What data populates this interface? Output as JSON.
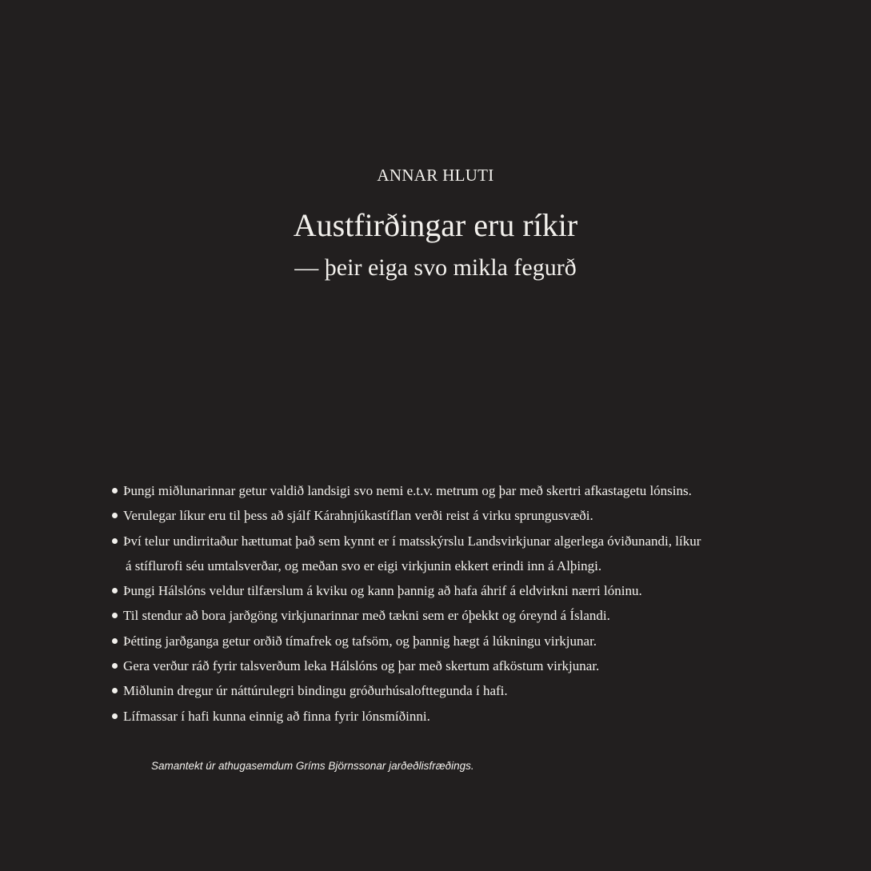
{
  "heading": {
    "part_label": "ANNAR HLUTI",
    "title": "Austfirðingar eru ríkir",
    "subtitle": "— þeir eiga svo mikla fegurð"
  },
  "bullets": [
    {
      "text": "Þungi miðlunarinnar getur valdið landsigi svo nemi e.t.v. metrum og þar með skertri afkastagetu lónsins."
    },
    {
      "text": "Verulegar líkur eru til þess að sjálf Kárahnjúkastíflan verði reist á virku sprungusvæði."
    },
    {
      "text": "Því telur undirritaður hættumat það sem kynnt er í matsskýrslu Landsvirkjunar algerlega óviðunandi, líkur",
      "continuation": "á stíflurofi séu umtalsverðar, og meðan svo er eigi virkjunin ekkert erindi inn á Alþingi."
    },
    {
      "text": "Þungi Hálslóns veldur tilfærslum á kviku og kann þannig að hafa áhrif á eldvirkni nærri lóninu."
    },
    {
      "text": "Til stendur að bora jarðgöng virkjunarinnar með tækni sem er óþekkt og óreynd á Íslandi."
    },
    {
      "text": "Þétting jarðganga getur orðið tímafrek og tafsöm, og þannig hægt á lúkningu virkjunar."
    },
    {
      "text": "Gera verður ráð fyrir talsverðum leka Hálslóns og þar með skertum afköstum virkjunar."
    },
    {
      "text": "Miðlunin dregur úr náttúrulegri bindingu gróðurhúsalofttegunda í hafi."
    },
    {
      "text": "Lífmassar í hafi kunna einnig að finna fyrir lónsmíðinni."
    }
  ],
  "source_note": "Samantekt úr athugasemdum Gríms Björnssonar jarðeðlisfræðings."
}
